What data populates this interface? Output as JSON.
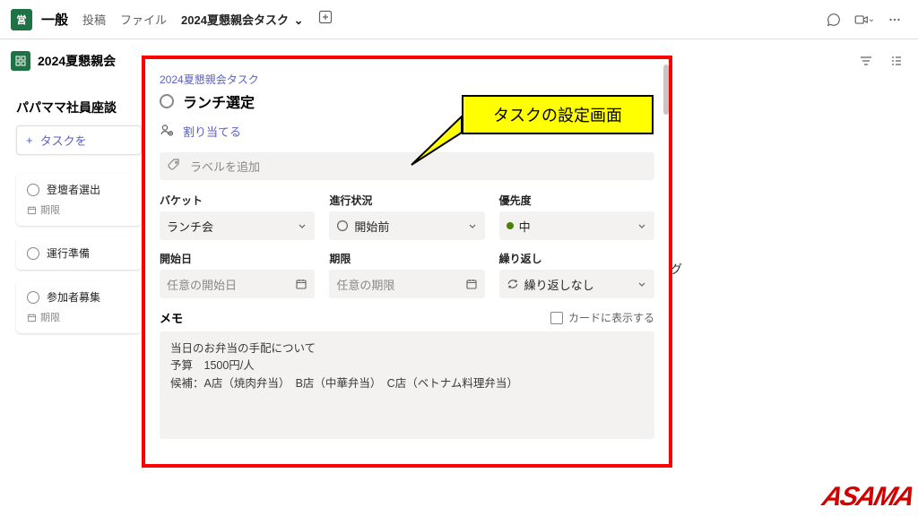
{
  "header": {
    "team_initial": "営",
    "channel": "一般",
    "tabs": {
      "posts": "投稿",
      "files": "ファイル",
      "active": "2024夏懇親会タスク"
    }
  },
  "plan": {
    "title": "2024夏懇親会"
  },
  "bucket": {
    "title": "パパママ社員座談",
    "add_task": "タスクを",
    "cards": [
      {
        "title": "登壇者選出",
        "deadline": "期限"
      },
      {
        "title": "運行準備"
      },
      {
        "title": "参加者募集",
        "deadline": "期限"
      }
    ]
  },
  "peek_right": "グ",
  "dialog": {
    "crumb": "2024夏懇親会タスク",
    "title": "ランチ選定",
    "assign": "割り当てる",
    "label_ph": "ラベルを追加",
    "f": {
      "bucket": {
        "lbl": "バケット",
        "val": "ランチ会"
      },
      "progress": {
        "lbl": "進行状況",
        "val": "開始前"
      },
      "priority": {
        "lbl": "優先度",
        "val": "中"
      },
      "start": {
        "lbl": "開始日",
        "ph": "任意の開始日"
      },
      "due": {
        "lbl": "期限",
        "ph": "任意の期限"
      },
      "repeat": {
        "lbl": "繰り返し",
        "val": "繰り返しなし"
      }
    },
    "memo": {
      "lbl": "メモ",
      "showcard": "カードに表示する",
      "text": "当日のお弁当の手配について\n予算　1500円/人\n候補：A店（焼肉弁当）　B店（中華弁当）　C店（ベトナム料理弁当）"
    }
  },
  "annotation": "タスクの設定画面",
  "logo": "ASAMA"
}
